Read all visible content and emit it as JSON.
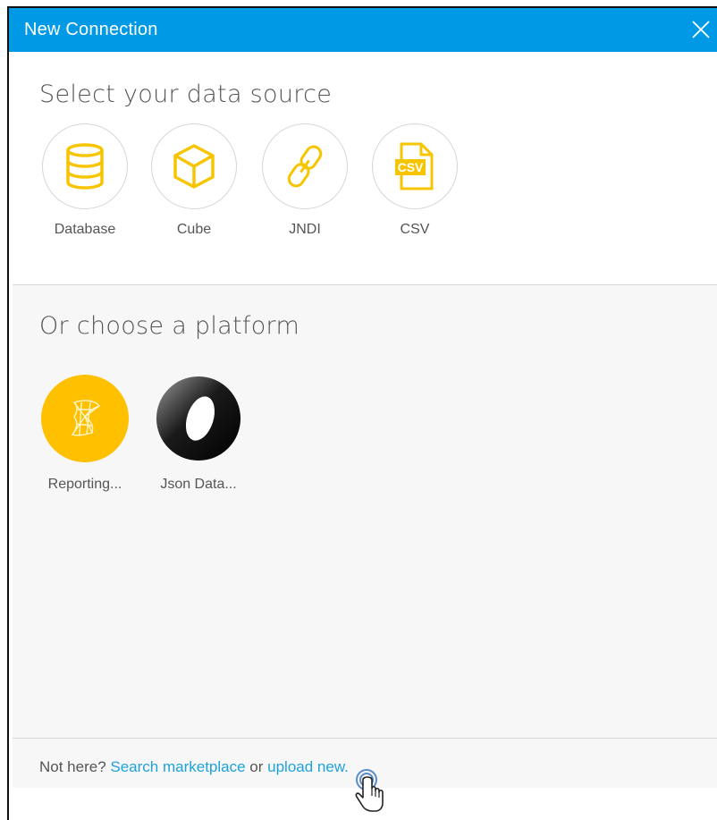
{
  "dialog": {
    "title": "New Connection"
  },
  "data_sources": {
    "heading": "Select your data source",
    "items": [
      {
        "label": "Database",
        "icon": "database-icon"
      },
      {
        "label": "Cube",
        "icon": "cube-icon"
      },
      {
        "label": "JNDI",
        "icon": "link-icon"
      },
      {
        "label": "CSV",
        "icon": "csv-file-icon",
        "icon_text": "CSV"
      }
    ]
  },
  "platforms": {
    "heading": "Or choose a platform",
    "items": [
      {
        "label": "Reporting...",
        "icon": "reporting-services-icon"
      },
      {
        "label": "Json Data...",
        "icon": "json-data-icon"
      }
    ]
  },
  "footer": {
    "prefix": "Not here? ",
    "marketplace_link": "Search marketplace",
    "middle": " or ",
    "upload_link": "upload new."
  },
  "colors": {
    "accent": "#0099e6",
    "icon": "#f7c500",
    "link": "#1ea2dc"
  }
}
